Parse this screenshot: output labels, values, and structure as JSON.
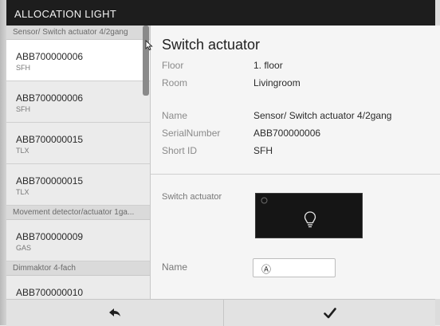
{
  "window": {
    "title": "ALLOCATION LIGHT"
  },
  "sidebar": {
    "entries": [
      {
        "kind": "header",
        "label": "Sensor/ Switch actuator 4/2gang"
      },
      {
        "kind": "item",
        "id": "ABB700000006",
        "sub": "SFH",
        "selected": true
      },
      {
        "kind": "item",
        "id": "ABB700000006",
        "sub": "SFH",
        "selected": false
      },
      {
        "kind": "item",
        "id": "ABB700000015",
        "sub": "TLX",
        "selected": false
      },
      {
        "kind": "item",
        "id": "ABB700000015",
        "sub": "TLX",
        "selected": false
      },
      {
        "kind": "header",
        "label": "Movement detector/actuator 1ga..."
      },
      {
        "kind": "item",
        "id": "ABB700000009",
        "sub": "GAS",
        "selected": false
      },
      {
        "kind": "header",
        "label": "Dimmaktor 4-fach"
      },
      {
        "kind": "item",
        "id": "ABB700000010",
        "sub": "",
        "selected": false
      }
    ]
  },
  "details": {
    "title": "Switch actuator",
    "floor_label": "Floor",
    "floor_value": "1. floor",
    "room_label": "Room",
    "room_value": "Livingroom",
    "name_label": "Name",
    "name_value": "Sensor/ Switch actuator 4/2gang",
    "serial_label": "SerialNumber",
    "serial_value": "ABB700000006",
    "shortid_label": "Short ID",
    "shortid_value": "SFH"
  },
  "config": {
    "switch_label": "Switch actuator",
    "tile_small_icon": "small-device-icon",
    "tile_icon": "light-bulb-icon",
    "name_label": "Name",
    "name_input_icon": "name-symbol-icon",
    "name_input_glyph": "Ⓐ"
  },
  "footer": {
    "back_icon": "back-arrow-icon",
    "confirm_icon": "checkmark-icon"
  },
  "colors": {
    "titlebar": "#1d1d1d",
    "tile": "#151515",
    "selected_item": "#ffffff"
  }
}
